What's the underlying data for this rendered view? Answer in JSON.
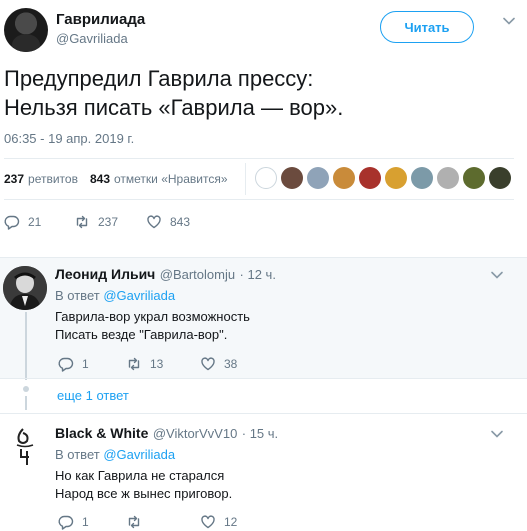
{
  "tweet": {
    "author_name": "Гаврилиада",
    "author_handle": "@Gavriliada",
    "follow_label": "Читать",
    "text_line1": "Предупредил Гаврила прессу:",
    "text_line2": "Нельзя писать «Гаврила — вор».",
    "time": "06:35 - 19 апр. 2019 г.",
    "retweets_count": "237",
    "retweets_label": "ретвитов",
    "likes_count": "843",
    "likes_label": "отметки «Нравится»",
    "actions": {
      "reply": "21",
      "retweet": "237",
      "like": "843"
    },
    "liker_colors": [
      "#c9c9c9",
      "#6b4b3e",
      "#8fa3b8",
      "#c98b3a",
      "#a8322c",
      "#d8a030",
      "#7c9aa8",
      "#b0b0b0",
      "#5d6b2e",
      "#3a3f2c"
    ]
  },
  "replies": [
    {
      "name": "Леонид Ильич",
      "handle": "@Bartolomju",
      "time": "· 12 ч.",
      "reply_prefix": "В ответ",
      "reply_to": "@Gavriliada",
      "line1": "Гаврила-вор украл возможность",
      "line2": "Писать везде \"Гаврила-вор\".",
      "actions": {
        "reply": "1",
        "retweet": "13",
        "like": "38"
      }
    },
    {
      "name": "Black & White",
      "handle": "@ViktorVvV10",
      "time": "· 15 ч.",
      "reply_prefix": "В ответ",
      "reply_to": "@Gavriliada",
      "line1": "Но как Гаврила не старался",
      "line2": "Народ все ж вынес приговор.",
      "actions": {
        "reply": "1",
        "retweet": "",
        "like": "12"
      }
    }
  ],
  "more_replies": "еще 1 ответ"
}
